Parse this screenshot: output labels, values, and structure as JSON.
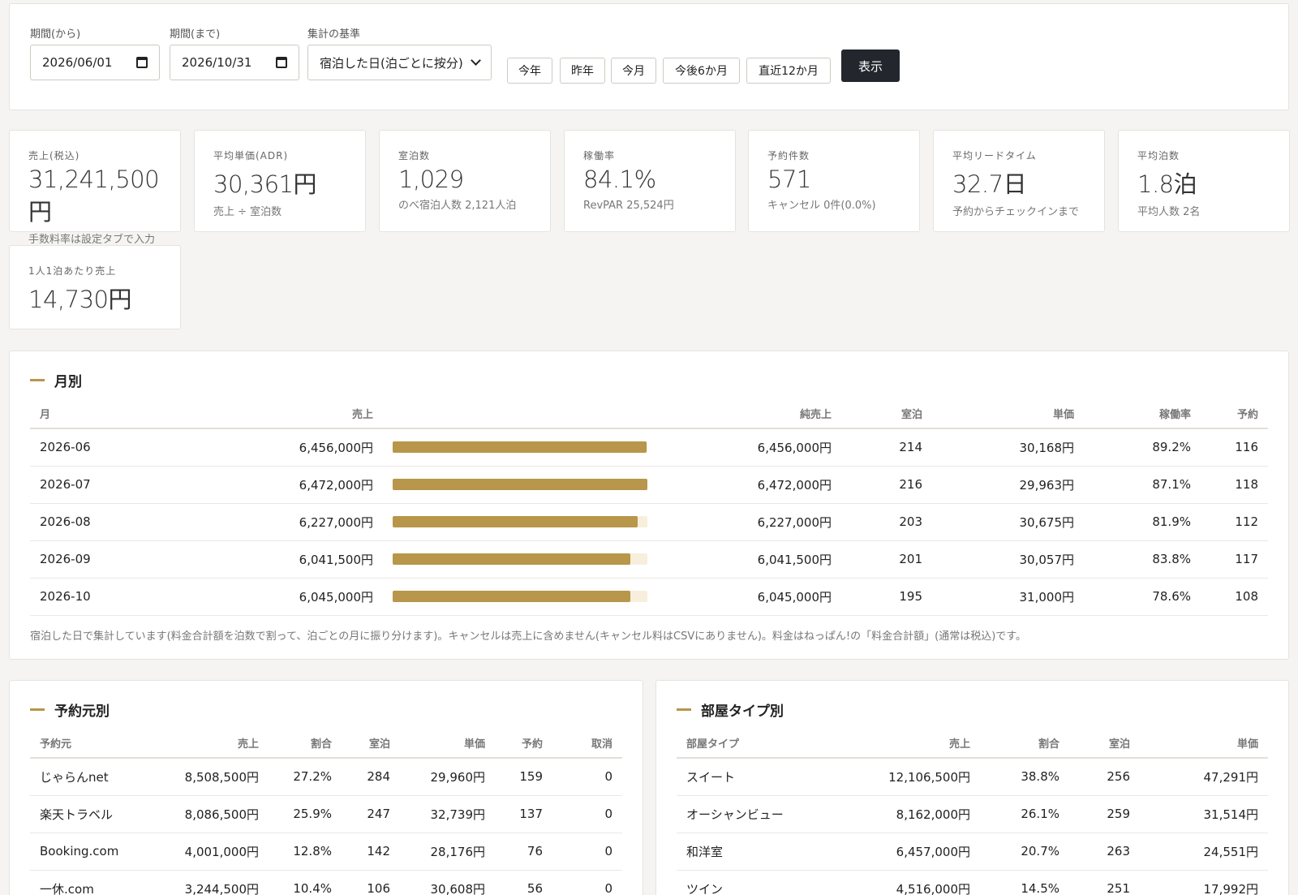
{
  "filters": {
    "from_label": "期間(から)",
    "from_value": "2026/06/01",
    "to_label": "期間(まで)",
    "to_value": "2026/10/31",
    "basis_label": "集計の基準",
    "basis_value": "宿泊した日(泊ごとに按分)",
    "quick": [
      "今年",
      "昨年",
      "今月",
      "今後6か月",
      "直近12か月"
    ],
    "show_label": "表示"
  },
  "kpis": [
    {
      "label": "売上(税込)",
      "value": "31,241,500円",
      "sub": "手数料率は設定タブで入力"
    },
    {
      "label": "平均単価(ADR)",
      "value": "30,361円",
      "sub": "売上 ÷ 室泊数"
    },
    {
      "label": "室泊数",
      "value": "1,029",
      "sub": "のべ宿泊人数 2,121人泊"
    },
    {
      "label": "稼働率",
      "value": "84.1%",
      "sub": "RevPAR 25,524円"
    },
    {
      "label": "予約件数",
      "value": "571",
      "sub": "キャンセル 0件(0.0%)"
    },
    {
      "label": "平均リードタイム",
      "value": "32.7日",
      "sub": "予約からチェックインまで"
    },
    {
      "label": "平均泊数",
      "value": "1.8泊",
      "sub": "平均人数 2名"
    },
    {
      "label": "1人1泊あたり売上",
      "value": "14,730円",
      "sub": ""
    }
  ],
  "monthly": {
    "title": "月別",
    "headers": [
      "月",
      "売上",
      "純売上",
      "室泊",
      "単価",
      "稼働率",
      "予約"
    ],
    "rows": [
      {
        "month": "2026-06",
        "sales": "6,456,000円",
        "ratio": 0.9975,
        "net": "6,456,000円",
        "nights": "214",
        "adr": "30,168円",
        "occ": "89.2%",
        "bookings": "116"
      },
      {
        "month": "2026-07",
        "sales": "6,472,000円",
        "ratio": 1.0,
        "net": "6,472,000円",
        "nights": "216",
        "adr": "29,963円",
        "occ": "87.1%",
        "bookings": "118"
      },
      {
        "month": "2026-08",
        "sales": "6,227,000円",
        "ratio": 0.9621,
        "net": "6,227,000円",
        "nights": "203",
        "adr": "30,675円",
        "occ": "81.9%",
        "bookings": "112"
      },
      {
        "month": "2026-09",
        "sales": "6,041,500円",
        "ratio": 0.9335,
        "net": "6,041,500円",
        "nights": "201",
        "adr": "30,057円",
        "occ": "83.8%",
        "bookings": "117"
      },
      {
        "month": "2026-10",
        "sales": "6,045,000円",
        "ratio": 0.934,
        "net": "6,045,000円",
        "nights": "195",
        "adr": "31,000円",
        "occ": "78.6%",
        "bookings": "108"
      }
    ],
    "note": "宿泊した日で集計しています(料金合計額を泊数で割って、泊ごとの月に振り分けます)。キャンセルは売上に含めません(キャンセル料はCSVにありません)。料金はねっぱん!の「料金合計額」(通常は税込)です。"
  },
  "by_channel": {
    "title": "予約元別",
    "headers": [
      "予約元",
      "売上",
      "割合",
      "室泊",
      "単価",
      "予約",
      "取消"
    ],
    "rows": [
      [
        "じゃらんnet",
        "8,508,500円",
        "27.2%",
        "284",
        "29,960円",
        "159",
        "0"
      ],
      [
        "楽天トラベル",
        "8,086,500円",
        "25.9%",
        "247",
        "32,739円",
        "137",
        "0"
      ],
      [
        "Booking.com",
        "4,001,000円",
        "12.8%",
        "142",
        "28,176円",
        "76",
        "0"
      ],
      [
        "一休.com",
        "3,244,500円",
        "10.4%",
        "106",
        "30,608円",
        "56",
        "0"
      ]
    ]
  },
  "by_room": {
    "title": "部屋タイプ別",
    "headers": [
      "部屋タイプ",
      "売上",
      "割合",
      "室泊",
      "単価"
    ],
    "rows": [
      [
        "スイート",
        "12,106,500円",
        "38.8%",
        "256",
        "47,291円"
      ],
      [
        "オーシャンビュー",
        "8,162,000円",
        "26.1%",
        "259",
        "31,514円"
      ],
      [
        "和洋室",
        "6,457,000円",
        "20.7%",
        "263",
        "24,551円"
      ],
      [
        "ツイン",
        "4,516,000円",
        "14.5%",
        "251",
        "17,992円"
      ]
    ]
  },
  "colors": {
    "accent": "#b8964a",
    "bar_track": "#f7efdc",
    "dark_button": "#23262d"
  }
}
